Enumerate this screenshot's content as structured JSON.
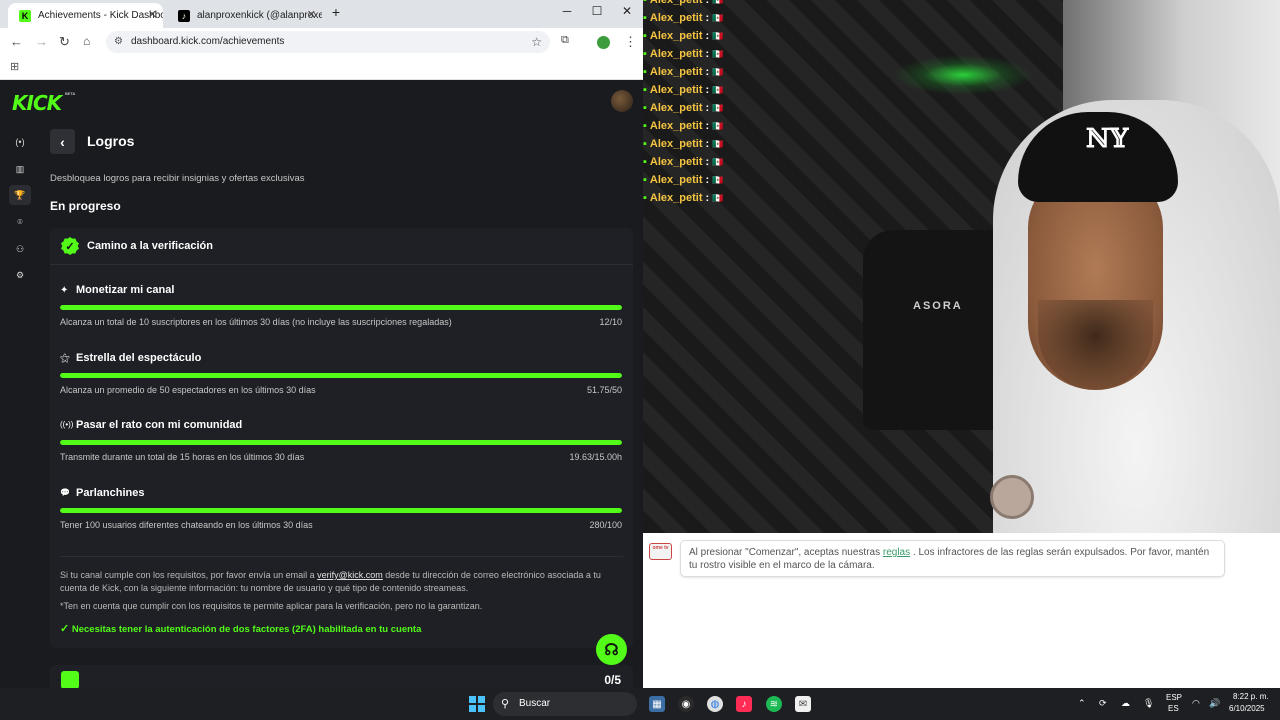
{
  "browser": {
    "tabs": [
      {
        "title": "Achievements - Kick Dashboard"
      },
      {
        "title": "alanproxenkick (@alanproxenk"
      }
    ],
    "new_tab": "+",
    "url": "dashboard.kick.com/achievements",
    "window_controls": {
      "minimize": "─",
      "maximize": "☐",
      "close": "✕"
    }
  },
  "kick": {
    "logo": "KICK",
    "beta": "BETA",
    "sidebar": [
      {
        "icon": "broadcast-icon",
        "glyph": "(•)"
      },
      {
        "icon": "analytics-icon",
        "glyph": "▥"
      },
      {
        "icon": "trophy-icon",
        "glyph": "🏆"
      },
      {
        "icon": "camera-icon",
        "glyph": "⌾"
      },
      {
        "icon": "users-icon",
        "glyph": "⚇"
      },
      {
        "icon": "settings-icon",
        "glyph": "⚙"
      }
    ],
    "page_title": "Logros",
    "subtitle": "Desbloquea logros para recibir insignias y ofertas exclusivas",
    "section_title": "En progreso",
    "card_title": "Camino a la verificación",
    "achievements": [
      {
        "icon": "sparkle-icon",
        "glyph": "✦",
        "name": "Monetizar mi canal",
        "desc": "Alcanza un total de 10 suscriptores en los últimos 30 días (no incluye las suscripciones regaladas)",
        "value": "12/10",
        "progress": 1.0
      },
      {
        "icon": "star-user-icon",
        "glyph": "⚝",
        "name": "Estrella del espectáculo",
        "desc": "Alcanza un promedio de 50 espectadores en los últimos 30 días",
        "value": "51.75/50",
        "progress": 1.0
      },
      {
        "icon": "broadcast-icon",
        "glyph": "((•))",
        "name": "Pasar el rato con mi comunidad",
        "desc": "Transmite durante un total de 15 horas en los últimos 30 días",
        "value": "19.63/15.00h",
        "progress": 1.0
      },
      {
        "icon": "chat-icon",
        "glyph": "💬",
        "name": "Parlanchines",
        "desc": "Tener 100 usuarios diferentes chateando en los últimos 30 días",
        "value": "280/100",
        "progress": 1.0
      }
    ],
    "info_pre": "Si tu canal cumple con los requisitos, por favor envía un email a ",
    "info_email": "verify@kick.com",
    "info_post": " desde tu dirección de correo electrónico asociada a tu cuenta de Kick, con la siguiente información: tu nombre de usuario y qué tipo de contenido streameas.",
    "note": "*Ten en cuenta que cumplir con los requisitos te permite aplicar para la verificación, pero no la garantizan.",
    "twofa": "Necesitas tener la autenticación de dos factores (2FA) habilitada en tu cuenta",
    "next_value": "0/5"
  },
  "chat": {
    "user": "Alex_petit",
    "sep": " :",
    "flag": "🇲🇽",
    "count": 12
  },
  "stream": {
    "chair_text": "ASORA"
  },
  "tos": {
    "pre": "Al presionar \"Comenzar\", aceptas nuestras ",
    "link": "reglas",
    "post": " . Los infractores de las reglas serán expulsados. Por favor, mantén tu rostro visible en el marco de la cámara.",
    "icon_text": "ome tv"
  },
  "taskbar": {
    "search": "Buscar",
    "lang1": "ESP",
    "lang2": "ES",
    "time": "8:22 p. m.",
    "date": "6/10/2025"
  },
  "colors": {
    "kick_green": "#53fc18",
    "chat_user": "#f5c542"
  }
}
